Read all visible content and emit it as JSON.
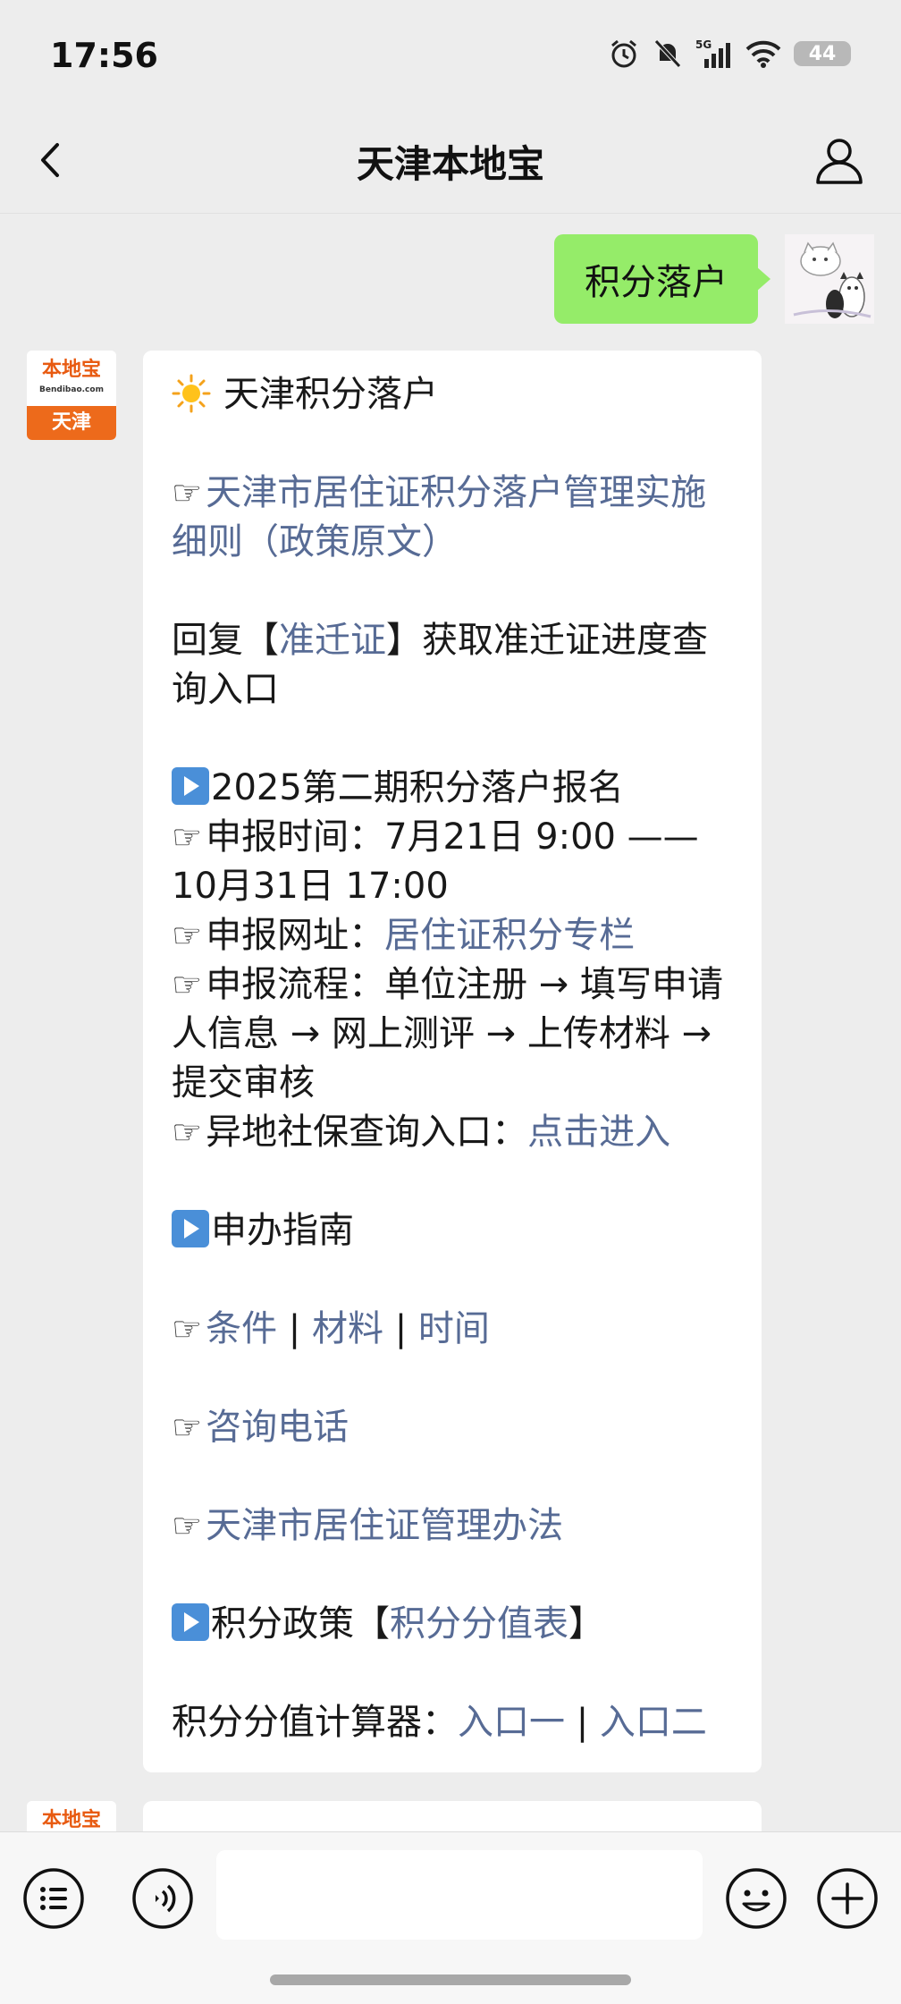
{
  "status_bar": {
    "time": "17:56",
    "battery": "44",
    "network": "5G"
  },
  "nav": {
    "title": "天津本地宝"
  },
  "user_message": {
    "text": "积分落户"
  },
  "bot_logo": {
    "top": "本地宝",
    "url": "Bendibao.com",
    "bottom": "天津"
  },
  "bot_message": {
    "title": "天津积分落户",
    "hand": "☞",
    "policy_link": "天津市居住证积分落户管理实施细则（政策原文）",
    "reply_prefix": "回复【",
    "reply_keyword": "准迁证",
    "reply_suffix": "】获取准迁证进度查询入口",
    "section1_title": "2025第二期积分落户报名",
    "apply_time": "申报时间：7月21日 9:00 —— 10月31日 17:00",
    "apply_url_label": "申报网址：",
    "apply_url_link": "居住证积分专栏",
    "apply_flow": "申报流程：单位注册 → 填写申请人信息 → 网上测评 → 上传材料 → 提交审核",
    "social_label": "异地社保查询入口：",
    "social_link": "点击进入",
    "section2_title": "申办指南",
    "guide_links": [
      "条件",
      "材料",
      "时间"
    ],
    "separator": " | ",
    "consult_link": "咨询电话",
    "management_link": "天津市居住证管理办法",
    "section3_prefix": "积分政策【",
    "section3_link": "积分分值表",
    "section3_suffix": "】",
    "calculator_label": "积分分值计算器：",
    "calculator_links": [
      "入口一",
      "入口二"
    ]
  },
  "colors": {
    "link": "#576b95",
    "user_bubble": "#95ec69",
    "background": "#ededed"
  },
  "input_bar": {
    "icons": [
      "menu-list-icon",
      "voice-icon",
      "emoji-icon",
      "plus-icon"
    ]
  }
}
